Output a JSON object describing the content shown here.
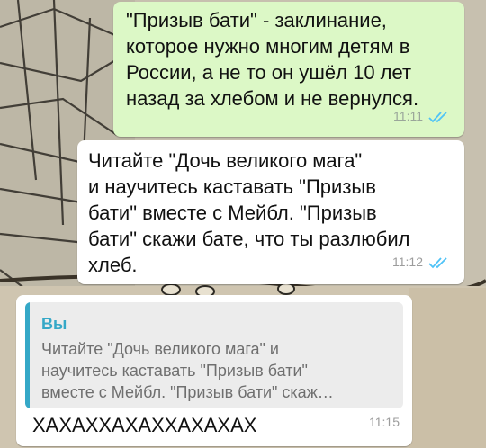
{
  "chat": {
    "messages": [
      {
        "direction": "outgoing",
        "text": "\"Призыв бати\" - заклинание,\nкоторое нужно многим детям в\nРоссии, а не то он ушёл 10 лет\nназад за хлебом и не вернулся.",
        "time": "11:11",
        "status": "read"
      },
      {
        "direction": "incoming",
        "text": "Читайте \"Дочь великого мага\"\nи научитесь каставать \"Призыв\nбати\" вместе с Мейбл. \"Призыв\nбати\" скажи бате, что ты разлюбил\nхлеб.",
        "time": "11:12",
        "status": "read"
      },
      {
        "direction": "incoming",
        "reply_to": {
          "author": "Вы",
          "preview": "Читайте \"Дочь великого мага\" и\nнаучитесь каставать \"Призыв бати\"\nвместе с Мейбл. \"Призыв бати\" скаж…"
        },
        "text": "ХАХАХХАХАХХАХАХАХ",
        "time": "11:15"
      }
    ]
  },
  "colors": {
    "outgoing_bubble": "#dcf8c6",
    "incoming_bubble": "#ffffff",
    "read_ticks": "#4fc3f7",
    "quote_accent": "#35a8c7"
  },
  "icons": {
    "read_receipt": "double-check-icon"
  }
}
